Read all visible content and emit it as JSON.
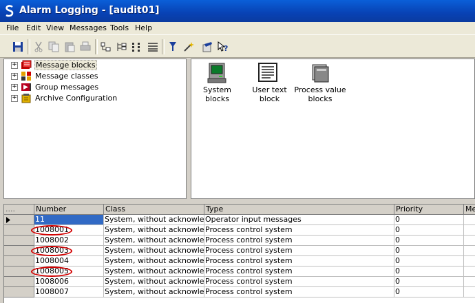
{
  "window": {
    "title": "Alarm Logging - [audit01]",
    "icon": "app-s-icon"
  },
  "menu": [
    "File",
    "Edit",
    "View",
    "Messages",
    "Tools",
    "Help"
  ],
  "toolbar": {
    "buttons": [
      "save-icon",
      "cut-icon",
      "copy-icon",
      "paste-icon",
      "print-icon",
      "view-small-icon",
      "view-tree-icon",
      "view-list-icon",
      "view-details-icon",
      "filter-icon",
      "wizard-icon",
      "properties-icon",
      "help-icon"
    ]
  },
  "tree": {
    "items": [
      {
        "label": "Message blocks",
        "icon": "message-blocks-icon",
        "selected": true
      },
      {
        "label": "Message classes",
        "icon": "message-classes-icon"
      },
      {
        "label": "Group messages",
        "icon": "group-messages-icon"
      },
      {
        "label": "Archive Configuration",
        "icon": "archive-icon"
      }
    ]
  },
  "blocks": [
    {
      "line1": "System blocks",
      "line2": "",
      "icon": "system-blocks-icon"
    },
    {
      "line1": "User text",
      "line2": "block",
      "icon": "user-text-block-icon"
    },
    {
      "line1": "Process value",
      "line2": "blocks",
      "icon": "process-value-blocks-icon"
    }
  ],
  "table": {
    "corner": "....",
    "columns": [
      "Number",
      "Class",
      "Type",
      "Priority",
      "Mes"
    ],
    "rows": [
      {
        "number": "11",
        "class": "System, without acknowledgm",
        "type": "Operator input messages",
        "priority": "0",
        "selected": true
      },
      {
        "number": "1008001",
        "class": "System, without acknowledgm",
        "type": "Process control system",
        "priority": "0",
        "circled": true
      },
      {
        "number": "1008002",
        "class": "System, without acknowledgm",
        "type": "Process control system",
        "priority": "0"
      },
      {
        "number": "1008003",
        "class": "System, without acknowledgm",
        "type": "Process control system",
        "priority": "0",
        "circled": true
      },
      {
        "number": "1008004",
        "class": "System, without acknowledgm",
        "type": "Process control system",
        "priority": "0"
      },
      {
        "number": "1008005",
        "class": "System, without acknowledgm",
        "type": "Process control system",
        "priority": "0",
        "circled": true
      },
      {
        "number": "1008006",
        "class": "System, without acknowledgm",
        "type": "Process control system",
        "priority": "0"
      },
      {
        "number": "1008007",
        "class": "System, without acknowledgm",
        "type": "Process control system",
        "priority": "0"
      }
    ]
  },
  "colors": {
    "selection": "#316ac5",
    "annotation": "#d40000",
    "titlebar": "#0842b4"
  }
}
